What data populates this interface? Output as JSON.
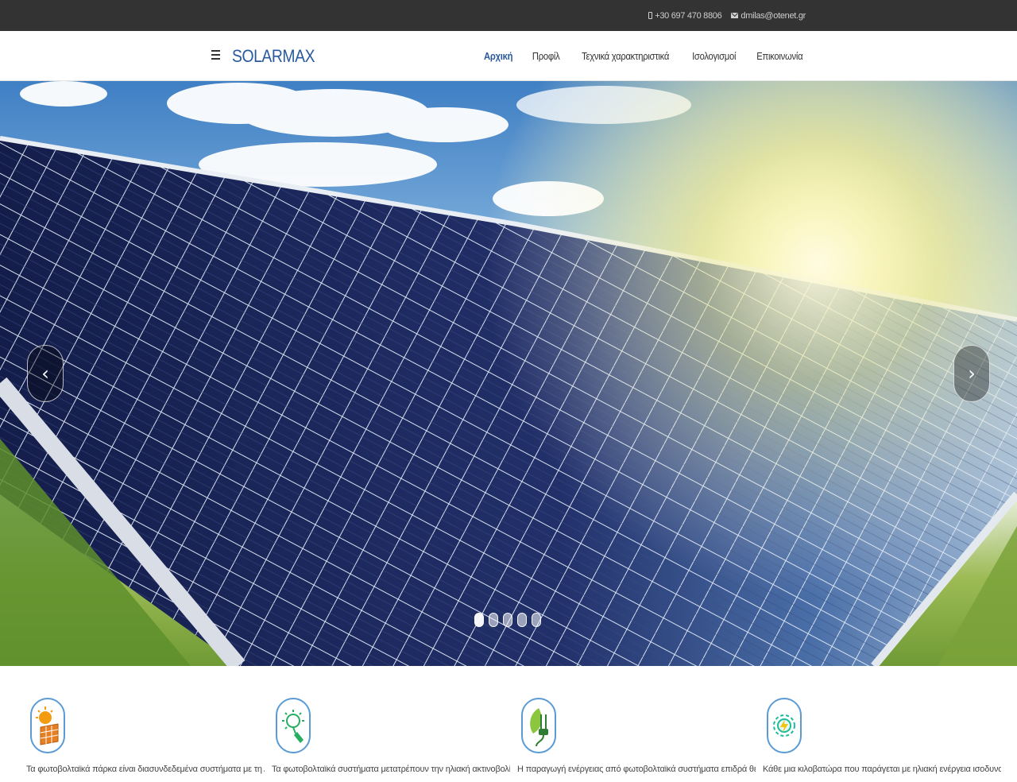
{
  "topbar": {
    "phone": "+30 697 470 8806",
    "email": "dmilas@otenet.gr"
  },
  "navbar": {
    "brand": "SOLARMAX",
    "items": [
      {
        "label": "Αρχική",
        "active": true
      },
      {
        "label": "Προφίλ",
        "active": false
      },
      {
        "label": "Τεχνικά χαρακτηριστικά",
        "active": false
      },
      {
        "label": "Ισολογισμοί",
        "active": false
      },
      {
        "label": "Επικοινωνία",
        "active": false
      }
    ]
  },
  "slider": {
    "prev_glyph": "‹",
    "next_glyph": "›",
    "slide_count": 5,
    "active_index": 0
  },
  "features": [
    {
      "icon": "solar-panel-sun-icon",
      "text": "Τα φωτοβολταϊκά πάρκα είναι διασυνδεδεμένα συστήματα με τη ΔΕΗ"
    },
    {
      "icon": "sun-plug-icon",
      "text": "Τα φωτοβολταϊκά συστήματα μετατρέπουν την ηλιακή ακτινοβολία σε"
    },
    {
      "icon": "leaf-plug-icon",
      "text": "Η παραγωγή ενέργειας από φωτοβολταϊκά συστήματα επιδρά θετικά"
    },
    {
      "icon": "energy-bolt-icon",
      "text": "Κάθε μια κιλοβατώρα που παράγεται με ηλιακή ενέργεια ισοδυναμεί με"
    }
  ],
  "colors": {
    "brand": "#2a5a9c",
    "topbar": "#333333",
    "icon_border": "#5b9bd5"
  }
}
